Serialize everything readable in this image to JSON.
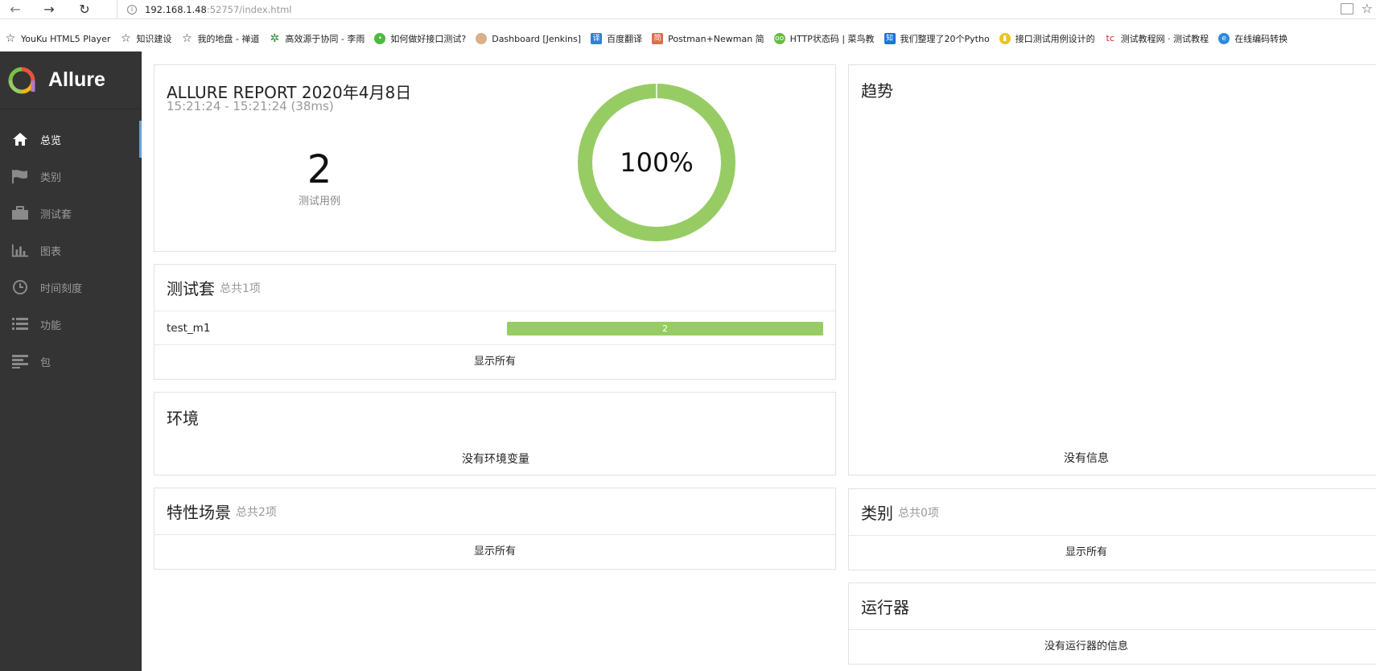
{
  "browser": {
    "url_host": "192.168.1.48",
    "url_path": ":52757/index.html",
    "bookmarks": [
      {
        "label": "YouKu HTML5 Player",
        "icon": "star-icon"
      },
      {
        "label": "知识建设",
        "icon": "star-icon"
      },
      {
        "label": "我的地盘 - 禅道",
        "icon": "star-icon"
      },
      {
        "label": "高效源于协同 - 李雨",
        "icon": "gear-icon"
      },
      {
        "label": "如何做好接口测试?",
        "icon": "chat-icon"
      },
      {
        "label": "Dashboard [Jenkins]",
        "icon": "jenkins-icon"
      },
      {
        "label": "百度翻译",
        "icon": "translate-icon"
      },
      {
        "label": "Postman+Newman 简",
        "icon": "jian-icon"
      },
      {
        "label": "HTTP状态码 | 菜鸟教",
        "icon": "runoob-icon"
      },
      {
        "label": "我们整理了20个Pytho",
        "icon": "zhihu-icon"
      },
      {
        "label": "接口测试用例设计的",
        "icon": "circle-icon"
      },
      {
        "label": "测试教程网 · 测试教程",
        "icon": "tc-icon"
      },
      {
        "label": "在线编码转换",
        "icon": "e-icon"
      }
    ]
  },
  "sidebar": {
    "brand": "Allure",
    "items": [
      {
        "label": "总览",
        "icon": "home-icon",
        "active": true
      },
      {
        "label": "类别",
        "icon": "flag-icon",
        "active": false
      },
      {
        "label": "测试套",
        "icon": "briefcase-icon",
        "active": false
      },
      {
        "label": "图表",
        "icon": "bar-chart-icon",
        "active": false
      },
      {
        "label": "时间刻度",
        "icon": "clock-icon",
        "active": false
      },
      {
        "label": "功能",
        "icon": "list-icon",
        "active": false
      },
      {
        "label": "包",
        "icon": "align-left-icon",
        "active": false
      }
    ]
  },
  "summary": {
    "title": "ALLURE REPORT 2020年4月8日",
    "time": "15:21:24 - 15:21:24 (38ms)",
    "count": "2",
    "count_label": "测试用例",
    "percent": "100%",
    "pass_fraction": 1.0
  },
  "suites": {
    "title": "测试套",
    "subtitle": "总共1项",
    "rows": [
      {
        "name": "test_m1",
        "passed": "2"
      }
    ],
    "show_all": "显示所有"
  },
  "environment": {
    "title": "环境",
    "empty": "没有环境变量"
  },
  "features": {
    "title": "特性场景",
    "subtitle": "总共2项",
    "show_all": "显示所有"
  },
  "trend": {
    "title": "趋势",
    "empty": "没有信息"
  },
  "categories": {
    "title": "类别",
    "subtitle": "总共0项",
    "show_all": "显示所有"
  },
  "executors": {
    "title": "运行器",
    "empty": "没有运行器的信息"
  },
  "colors": {
    "passed": "#97cc64",
    "sidebar": "#343434",
    "active_marker": "#6fa0ce"
  }
}
